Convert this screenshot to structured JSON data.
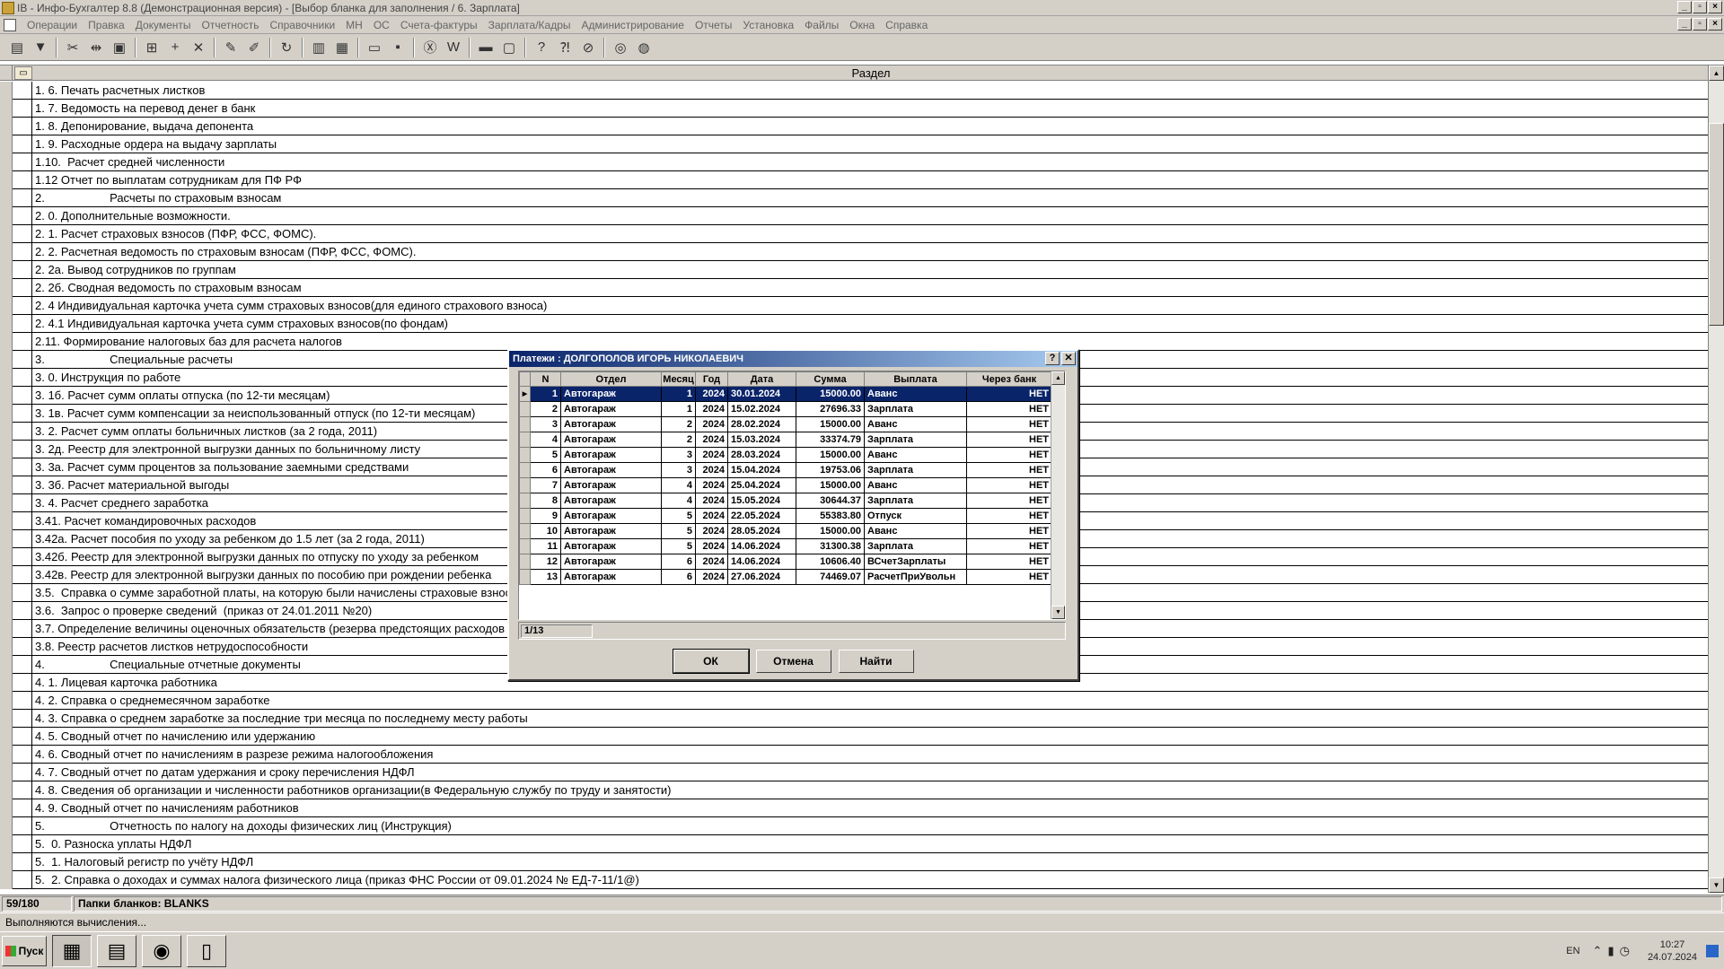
{
  "window": {
    "title": "IB - Инфо-Бухгалтер 8.8 (Демонстрационная версия) - [Выбор бланка для заполнения /    6. Зарплата]"
  },
  "menu": [
    "Операции",
    "Правка",
    "Документы",
    "Отчетность",
    "Справочники",
    "МН",
    "ОС",
    "Счета-фактуры",
    "Зарплата/Кадры",
    "Администрирование",
    "Отчеты",
    "Установка",
    "Файлы",
    "Окна",
    "Справка"
  ],
  "toolbar_icons": [
    "form-icon",
    "filter-icon",
    "cut-icon",
    "split-icon",
    "paste-icon",
    "calc-icon",
    "add-icon",
    "delete-icon",
    "mark-icon",
    "unmark-icon",
    "refresh-icon",
    "pdf-icon",
    "table-icon",
    "open-icon",
    "save-icon",
    "excel-icon",
    "word-icon",
    "print-icon",
    "preview-icon",
    "help-icon",
    "context-help-icon",
    "compass-icon",
    "lifebuoy-icon",
    "globe-icon"
  ],
  "grid": {
    "header": "Раздел",
    "rows": [
      "1. 6. Печать расчетных листков",
      "1. 7. Ведомость на перевод денег в банк",
      "1. 8. Депонирование, выдача депонента",
      "1. 9. Расходные ордера на выдачу зарплаты",
      "1.10.  Расчет средней численности",
      "1.12 Отчет по выплатам сотрудникам для ПФ РФ",
      "2.                    Расчеты по страховым взносам",
      "2. 0. Дополнительные возможности.",
      "2. 1. Расчет страховых взносов (ПФР, ФСС, ФОМС).",
      "2. 2. Расчетная ведомость по страховым взносам (ПФР, ФСС, ФОМС).",
      "2. 2а. Вывод сотрудников по группам",
      "2. 2б. Сводная ведомость по страховым взносам",
      "2. 4 Индивидуальная карточка учета сумм страховых взносов(для единого страхового взноса)",
      "2. 4.1 Индивидуальная карточка учета сумм страховых взносов(по фондам)",
      "2.11. Формирование налоговых баз для расчета налогов",
      "3.                    Специальные расчеты",
      "3. 0. Инструкция по работе",
      "3. 1б. Расчет сумм оплаты отпуска (по 12-ти месяцам)",
      "3. 1в. Расчет сумм компенсации за неиспользованный отпуск (по 12-ти месяцам)",
      "3. 2. Расчет сумм оплаты больничных листков (за 2 года, 2011)",
      "3. 2д. Реестр для электронной выгрузки данных по больничному листу",
      "3. 3а. Расчет сумм процентов за пользование заемными средствами",
      "3. 3б. Расчет материальной выгоды",
      "3. 4. Расчет среднего заработка",
      "3.41. Расчет командировочных расходов",
      "3.42а. Расчет пособия по уходу за ребенком до 1.5 лет (за 2 года, 2011)",
      "3.42б. Реестр для электронной выгрузки данных по отпуску по уходу за ребенком",
      "3.42в. Реестр для электронной выгрузки данных по пособию при рождении ребенка",
      "3.5.  Справка о сумме заработной платы, на которую были начислены страховые взносы",
      "3.6.  Запрос о проверке сведений  (приказ от 24.01.2011 №20)",
      "3.7. Определение величины оценочных обязательств (резерва предстоящих расходов",
      "3.8. Реестр расчетов листков нетрудоспособности",
      "4.                    Специальные отчетные документы",
      "4. 1. Лицевая карточка работника",
      "4. 2. Справка о среднемесячном заработке",
      "4. 3. Справка о среднем заработке за последние три месяца по последнему месту работы",
      "4. 5. Сводный отчет по начислению или удержанию",
      "4. 6. Сводный отчет по начислениям в разрезе режима налогообложения",
      "4. 7. Сводный отчет по датам удержания и сроку перечисления НДФЛ",
      "4. 8. Сведения об организации и численности работников организации(в Федеральную службу по труду и занятости)",
      "4. 9. Сводный отчет по начислениям работников",
      "5.                    Отчетность по налогу на доходы физических лиц (Инструкция)",
      "5.  0. Разноска уплаты НДФЛ",
      "5.  1. Налоговый регистр по учёту НДФЛ",
      "5.  2. Справка о доходах и суммах налога физического лица (приказ ФНС России от 09.01.2024 № ЕД-7-11/1@)"
    ]
  },
  "status": {
    "position": "59/180",
    "folder": "Папки бланков: BLANKS",
    "message": "Выполняются вычисления..."
  },
  "dialog": {
    "title": "Платежи : ДОЛГОПОЛОВ ИГОРЬ НИКОЛАЕВИЧ",
    "help_btn": "?",
    "close_btn": "✕",
    "columns": [
      "N",
      "Отдел",
      "Месяц",
      "Год",
      "Дата",
      "Сумма",
      "Выплата",
      "Через банк"
    ],
    "rows": [
      [
        "1",
        "Автогараж",
        "1",
        "2024",
        "30.01.2024",
        "15000.00",
        "Аванс",
        "НЕТ"
      ],
      [
        "2",
        "Автогараж",
        "1",
        "2024",
        "15.02.2024",
        "27696.33",
        "Зарплата",
        "НЕТ"
      ],
      [
        "3",
        "Автогараж",
        "2",
        "2024",
        "28.02.2024",
        "15000.00",
        "Аванс",
        "НЕТ"
      ],
      [
        "4",
        "Автогараж",
        "2",
        "2024",
        "15.03.2024",
        "33374.79",
        "Зарплата",
        "НЕТ"
      ],
      [
        "5",
        "Автогараж",
        "3",
        "2024",
        "28.03.2024",
        "15000.00",
        "Аванс",
        "НЕТ"
      ],
      [
        "6",
        "Автогараж",
        "3",
        "2024",
        "15.04.2024",
        "19753.06",
        "Зарплата",
        "НЕТ"
      ],
      [
        "7",
        "Автогараж",
        "4",
        "2024",
        "25.04.2024",
        "15000.00",
        "Аванс",
        "НЕТ"
      ],
      [
        "8",
        "Автогараж",
        "4",
        "2024",
        "15.05.2024",
        "30644.37",
        "Зарплата",
        "НЕТ"
      ],
      [
        "9",
        "Автогараж",
        "5",
        "2024",
        "22.05.2024",
        "55383.80",
        "Отпуск",
        "НЕТ"
      ],
      [
        "10",
        "Автогараж",
        "5",
        "2024",
        "28.05.2024",
        "15000.00",
        "Аванс",
        "НЕТ"
      ],
      [
        "11",
        "Автогараж",
        "5",
        "2024",
        "14.06.2024",
        "31300.38",
        "Зарплата",
        "НЕТ"
      ],
      [
        "12",
        "Автогараж",
        "6",
        "2024",
        "14.06.2024",
        "10606.40",
        "ВСчетЗарплаты",
        "НЕТ"
      ],
      [
        "13",
        "Автогараж",
        "6",
        "2024",
        "27.06.2024",
        "74469.07",
        "РасчетПриУвольн",
        "НЕТ"
      ]
    ],
    "record_pos": "1/13",
    "ok_label": "ОК",
    "cancel_label": "Отмена",
    "find_label": "Найти"
  },
  "taskbar": {
    "start_label": "Пуск",
    "apps": [
      "accounting-app-icon",
      "calculator-icon",
      "chrome-icon",
      "folder-icon"
    ],
    "lang": "EN",
    "time": "10:27",
    "date": "24.07.2024"
  }
}
